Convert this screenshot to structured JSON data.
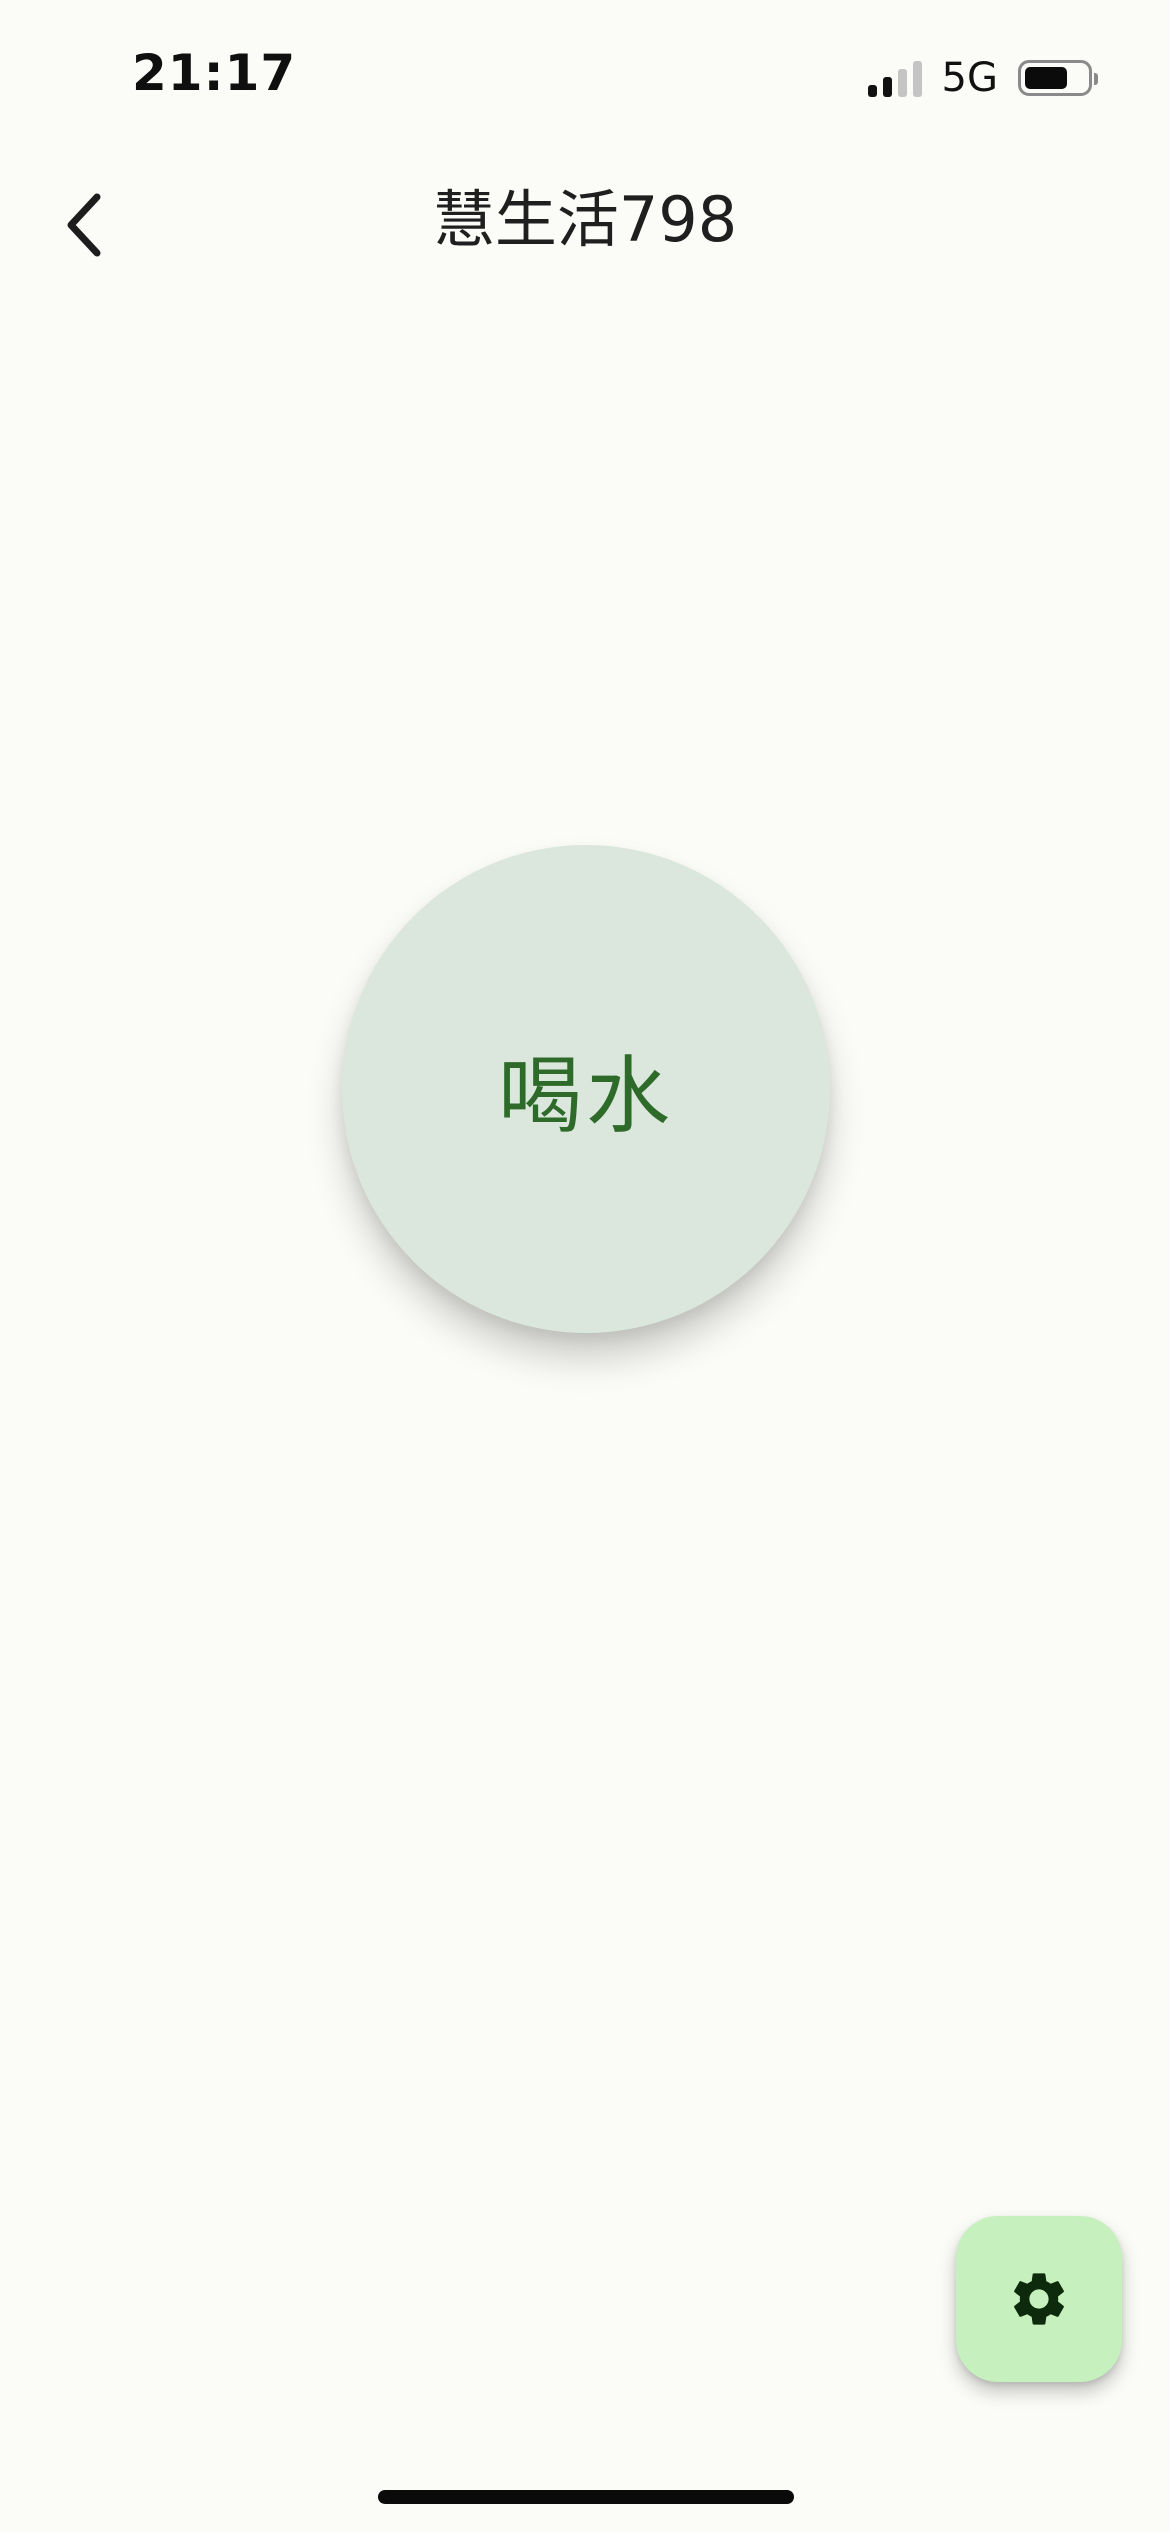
{
  "status_bar": {
    "time": "21:17",
    "network": "5G",
    "signal_bars_active": 2,
    "signal_bars_total": 4,
    "battery_level": 0.7
  },
  "header": {
    "title": "慧生活798",
    "back_icon": "chevron-left-icon"
  },
  "main": {
    "drink_button_label": "喝水",
    "drink_button_color": "#dbe7dc",
    "drink_label_color": "#2e6b2a"
  },
  "fab": {
    "icon": "gear-icon",
    "background": "#c6f0bd"
  }
}
